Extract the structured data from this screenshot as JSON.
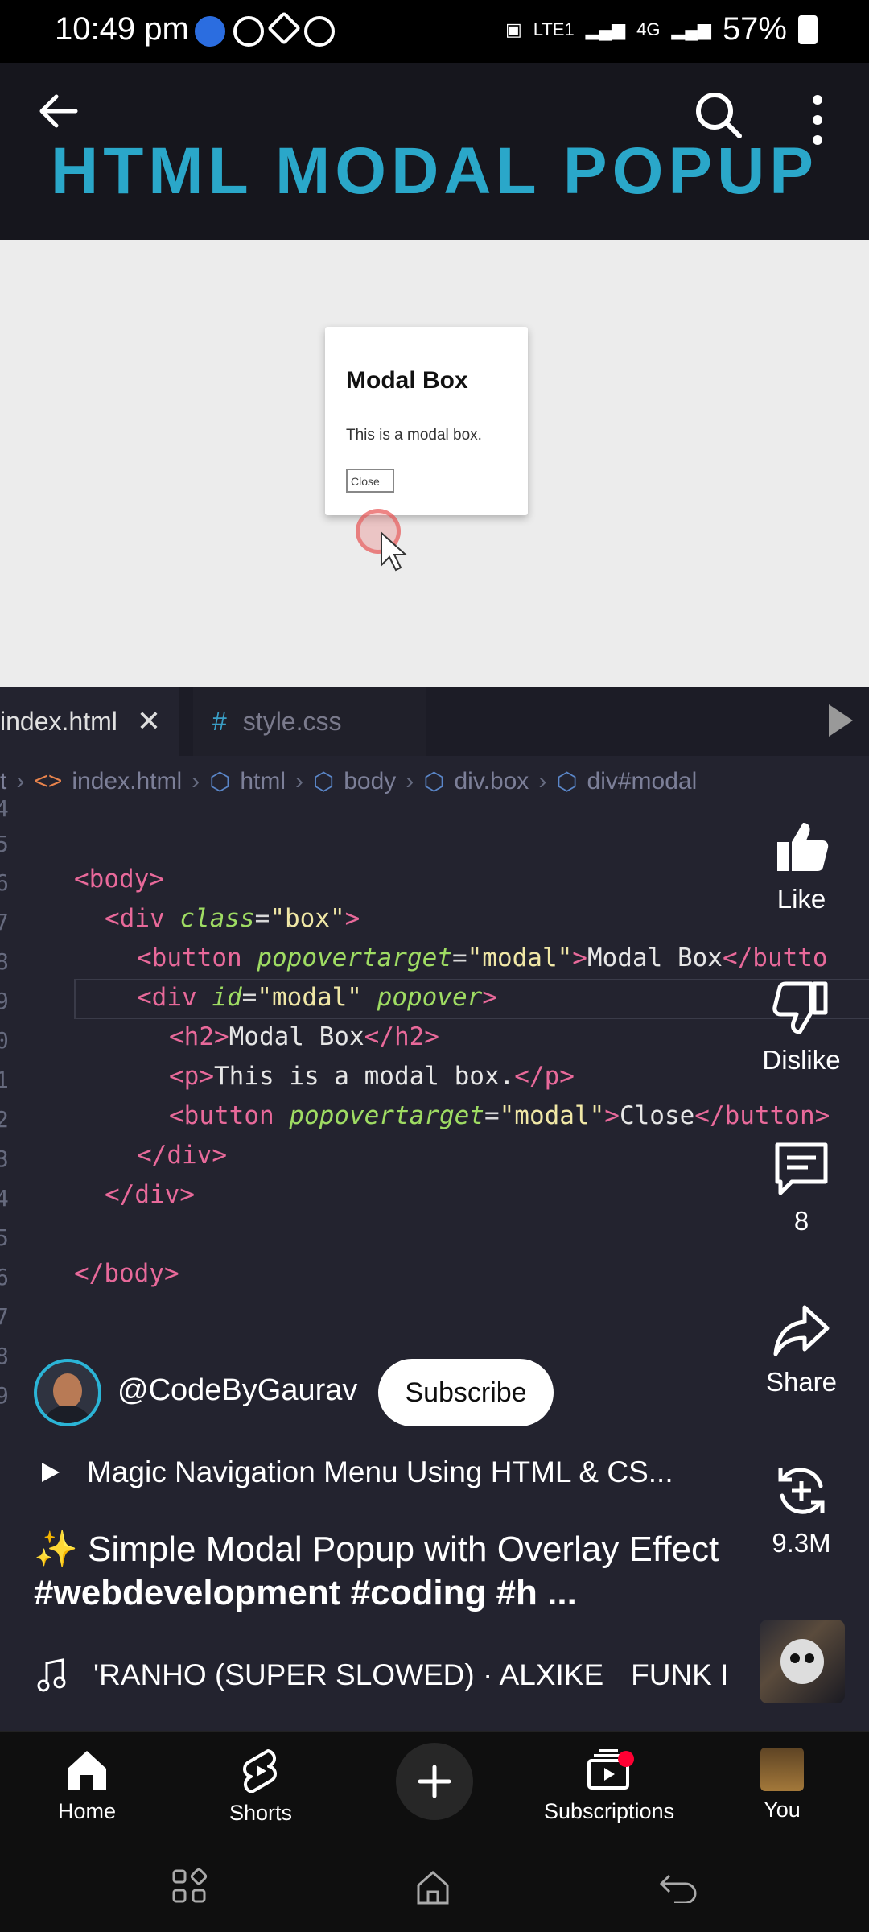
{
  "status_bar": {
    "time": "10:49 pm",
    "network": "LTE1",
    "network_gen": "4G",
    "battery": "57%"
  },
  "video": {
    "overlay_title": "HTML MODAL POPUP",
    "modal_heading": "Modal Box",
    "modal_text": "This is a modal box.",
    "modal_button": "Close"
  },
  "editor": {
    "tabs": [
      {
        "label": "index.html",
        "close": "✕"
      },
      {
        "label": "style.css",
        "icon": "#"
      }
    ],
    "breadcrumb": [
      "t",
      "index.html",
      "html",
      "body",
      "div.box",
      "div#modal"
    ],
    "line_numbers": [
      "4",
      "5",
      "6",
      "7",
      "8",
      "9",
      "0",
      "1",
      "2",
      "3",
      "4",
      "5",
      "6",
      "7",
      "8",
      "9"
    ]
  },
  "actions": {
    "like": "Like",
    "dislike": "Dislike",
    "comments": "8",
    "share": "Share",
    "remix": "9.3M"
  },
  "channel": {
    "handle": "@CodeByGaurav",
    "subscribe": "Subscribe"
  },
  "playlist": "Magic Navigation Menu Using HTML & CS...",
  "description": {
    "emoji": "✨",
    "text_a": "Simple Modal Popup with Overlay Effect",
    "tags": "#webdevelopment #coding #h ..."
  },
  "music": {
    "track": "'RANHO (SUPER SLOWED) · ALXIKE",
    "next": "FUNK I"
  },
  "nav": {
    "home": "Home",
    "shorts": "Shorts",
    "subscriptions": "Subscriptions",
    "you": "You"
  },
  "colors": {
    "accent_title": "#2aa7c9",
    "editor_bg": "#23232f",
    "tag_color": "#e8699a",
    "attr_color": "#9fdc63",
    "string_color": "#f0e7a6",
    "notification": "#ff0033"
  }
}
